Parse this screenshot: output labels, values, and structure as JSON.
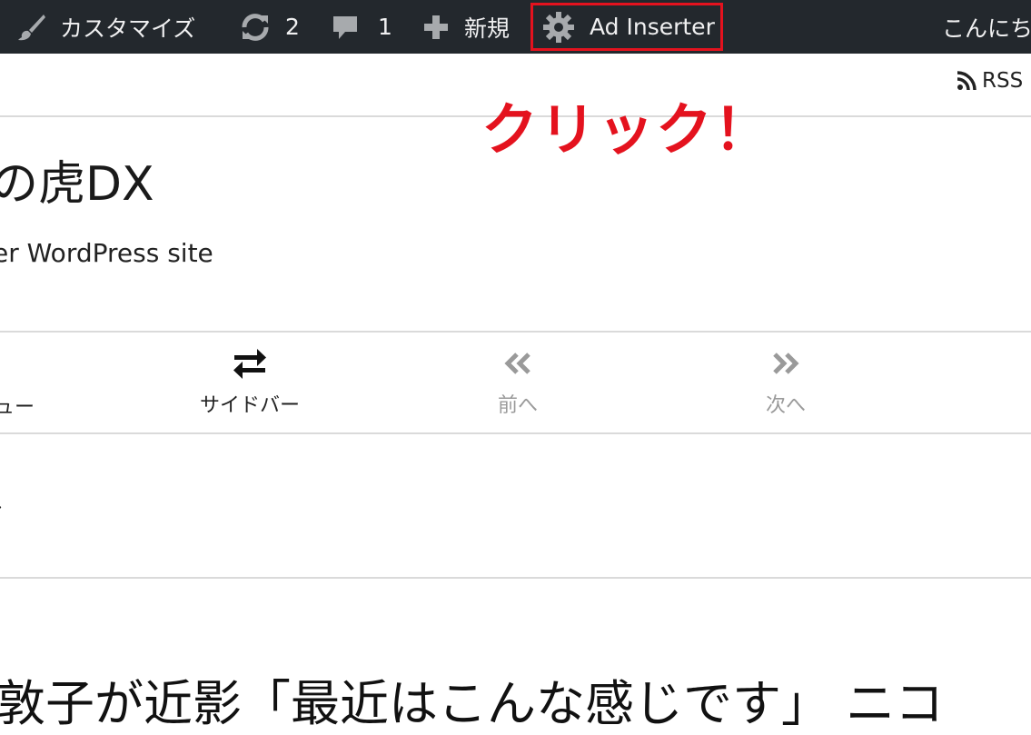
{
  "adminbar": {
    "customize_label": "カスタマイズ",
    "updates_count": "2",
    "comments_count": "1",
    "new_label": "新規",
    "ad_inserter_label": "Ad Inserter",
    "greeting": "こんにち"
  },
  "header": {
    "rss_label": "RSS",
    "site_title": "の虎DX",
    "tagline": "er WordPress site"
  },
  "annotation": {
    "text": "クリック！",
    "color": "#e4121e"
  },
  "nav": {
    "partial_label": "ュー",
    "sidebar_label": "サイドバー",
    "prev_label": "前へ",
    "next_label": "次へ"
  },
  "article": {
    "partial_mark": "›",
    "headline": "敦子が近影「最近はこんな感じです」 ニコ"
  },
  "colors": {
    "adminbar_bg": "#23282d",
    "highlight": "#e4121e",
    "disabled": "#9a9a9a"
  }
}
